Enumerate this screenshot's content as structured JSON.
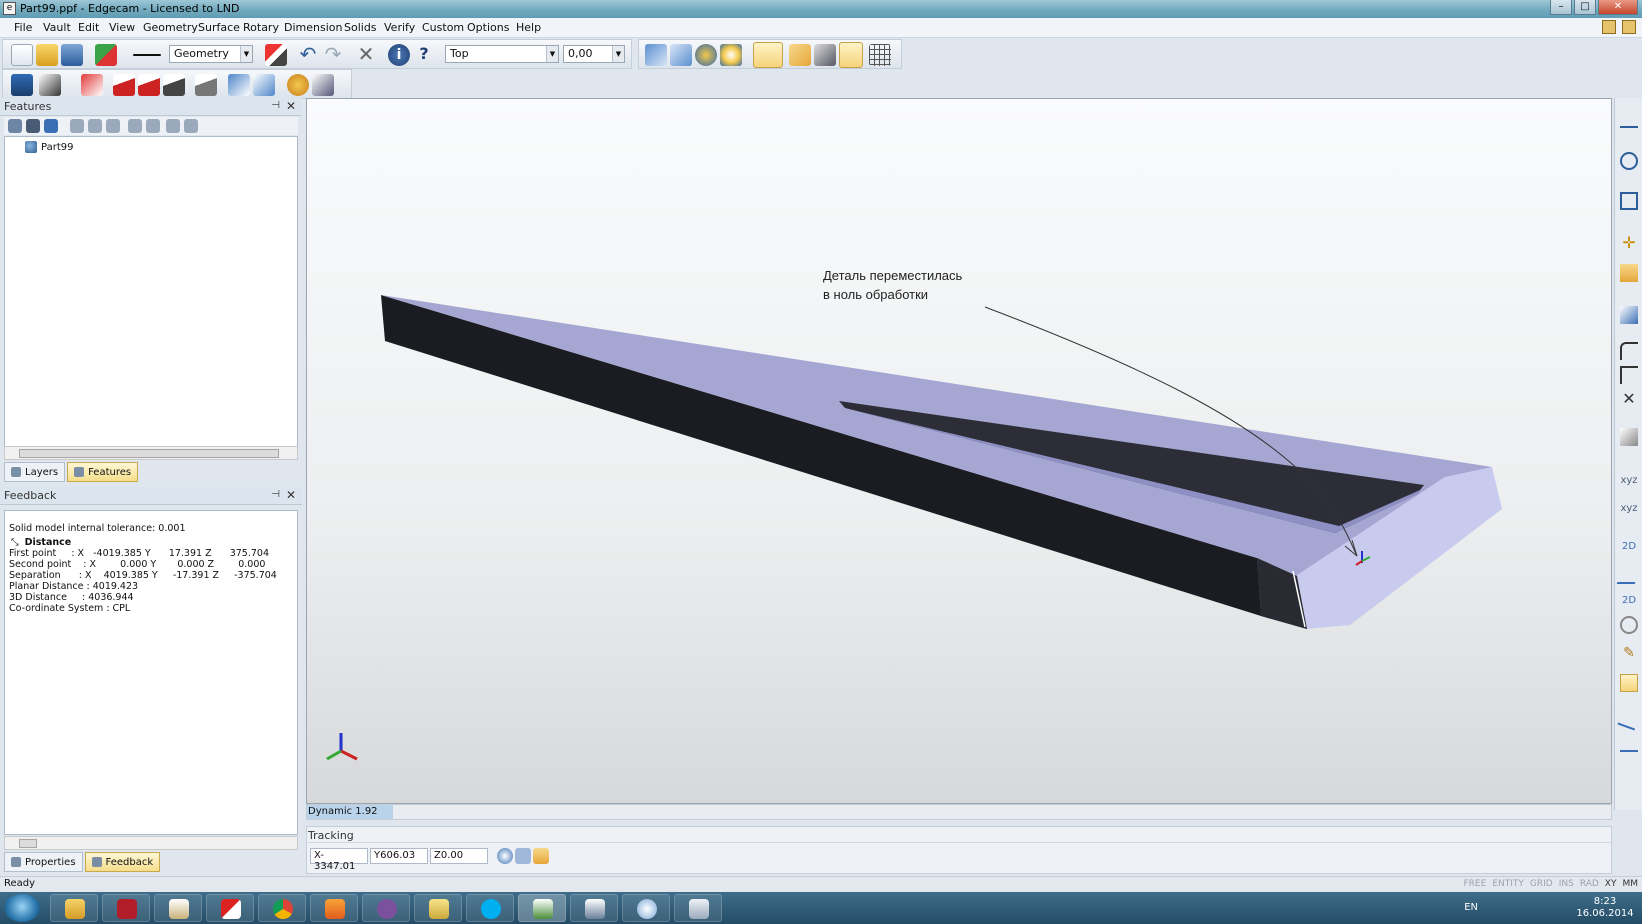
{
  "window": {
    "title": "Part99.ppf - Edgecam - Licensed to LND",
    "app_icon": "edgecam-icon",
    "controls": {
      "minimize": "–",
      "maximize": "□",
      "close": "✕"
    }
  },
  "menu": {
    "items": [
      "File",
      "Vault",
      "Edit",
      "View",
      "Geometry",
      "Surface",
      "Rotary",
      "Dimension",
      "Solids",
      "Verify",
      "Custom",
      "Options",
      "Help"
    ]
  },
  "toolbar": {
    "layer_combo": "Geometry",
    "view_combo": "Top",
    "depth_combo": "0,00"
  },
  "features_panel": {
    "title": "Features",
    "tree_root": "Part99",
    "tabs": [
      "Layers",
      "Features"
    ]
  },
  "feedback_panel": {
    "title": "Feedback",
    "tolerance": "Solid model internal tolerance: 0.001",
    "measure_title": "Distance",
    "lines": [
      "First point     : X   -4019.385 Y      17.391 Z      375.704",
      "Second point    : X        0.000 Y       0.000 Z        0.000",
      "Separation      : X    4019.385 Y     -17.391 Z     -375.704",
      "Planar Distance : 4019.423",
      "3D Distance     : 4036.944",
      "Co-ordinate System : CPL"
    ],
    "tabs": [
      "Properties",
      "Feedback"
    ]
  },
  "viewport": {
    "annotation_line1": "Деталь переместилась",
    "annotation_line2": "в ноль обработки",
    "colors": {
      "top_face": "#a5a6d2",
      "side_face": "#1b1b22",
      "end_face": "#c9cbee"
    }
  },
  "dynamic_bar": {
    "label": "Dynamic 1.92"
  },
  "tracking": {
    "title": "Tracking",
    "x": "X-3347.01",
    "y": "Y606.03",
    "z": "Z0.00"
  },
  "statusbar": {
    "ready": "Ready",
    "modes": [
      "FREE",
      "ENTITY",
      "GRID",
      "INS",
      "RAD",
      "XY",
      "MM"
    ]
  },
  "taskbar": {
    "apps": [
      "explorer-icon",
      "cad-app-icon",
      "pro-app-icon",
      "solidworks-icon",
      "chrome-icon",
      "media-player-icon",
      "viber-icon",
      "folder-icon",
      "skype-icon",
      "edgecam-icon",
      "edgecam-icon",
      "paint-icon",
      "calculator-icon"
    ],
    "language": "EN",
    "time": "8:23",
    "date": "16.06.2014"
  }
}
